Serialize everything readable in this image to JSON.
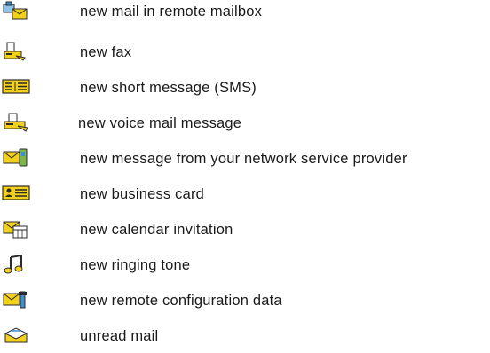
{
  "legend": {
    "items": [
      {
        "icon": "remote-mailbox-icon",
        "label": "new mail in remote mailbox"
      },
      {
        "icon": "fax-icon",
        "label": "new fax"
      },
      {
        "icon": "sms-icon",
        "label": "new short message (SMS)"
      },
      {
        "icon": "voice-mail-icon",
        "label": "new voice mail message"
      },
      {
        "icon": "network-provider-message-icon",
        "label": "new message from your network service provider"
      },
      {
        "icon": "business-card-icon",
        "label": "new business card"
      },
      {
        "icon": "calendar-invitation-icon",
        "label": "new calendar invitation"
      },
      {
        "icon": "ringing-tone-icon",
        "label": "new ringing tone"
      },
      {
        "icon": "remote-configuration-icon",
        "label": "new remote configuration data"
      },
      {
        "icon": "unread-mail-icon",
        "label": "unread mail"
      }
    ]
  },
  "colors": {
    "icon_yellow": "#f2d01c",
    "icon_outline": "#2b2b2b",
    "icon_blue": "#3e8fd0",
    "text": "#1a1a1a"
  }
}
